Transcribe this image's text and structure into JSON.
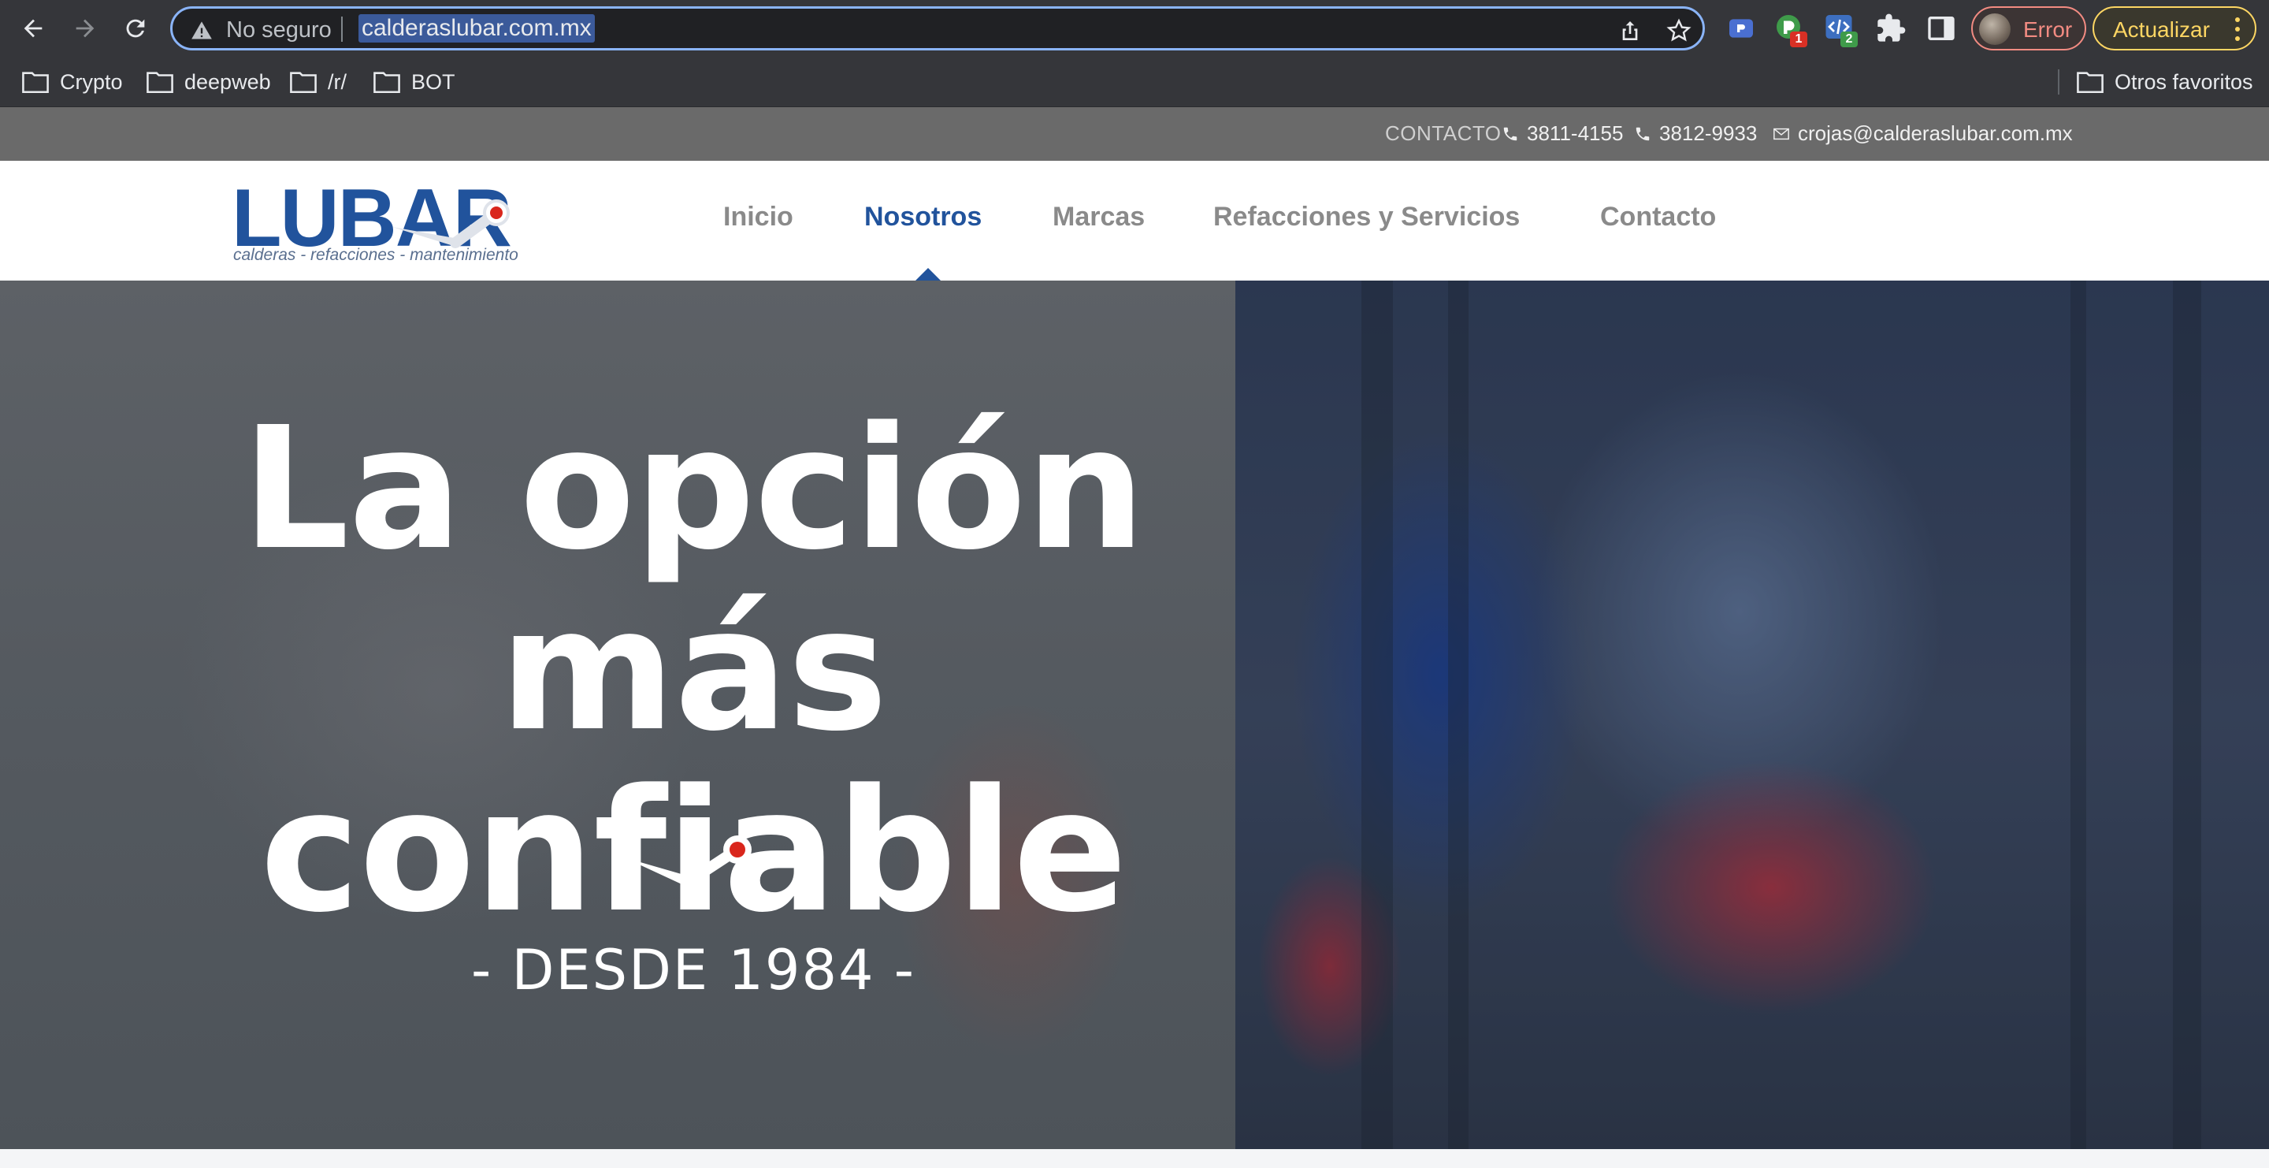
{
  "browser": {
    "security_label": "No seguro",
    "url": "calderaslubar.com.mx",
    "extension_badges": [
      "1",
      "2"
    ],
    "profile_label": "Error",
    "update_label": "Actualizar",
    "icons": [
      "back-icon",
      "forward-icon",
      "reload-icon",
      "warning-icon",
      "share-icon",
      "star-icon",
      "extension-icon",
      "puzzle-icon",
      "sidepanel-icon",
      "more-icon",
      "folder-icon"
    ],
    "accent_colors": {
      "focus": "#8ab4f8",
      "error": "#f28b82",
      "update": "#fdd663"
    }
  },
  "bookmarks": {
    "items": [
      "Crypto",
      "deepweb",
      "/r/",
      "BOT"
    ],
    "other": "Otros favoritos"
  },
  "site": {
    "topbar": {
      "contact_label": "CONTACTO",
      "phone1": "3811-4155",
      "phone2": "3812-9933",
      "email": "crojas@calderaslubar.com.mx"
    },
    "logo": {
      "word": "LUBAR",
      "tagline": "calderas - refacciones - mantenimiento"
    },
    "nav": [
      {
        "label": "Inicio",
        "active": false
      },
      {
        "label": "Nosotros",
        "active": true
      },
      {
        "label": "Marcas",
        "active": false
      },
      {
        "label": "Refacciones y Servicios",
        "active": false
      },
      {
        "label": "Contacto",
        "active": false
      }
    ],
    "hero": {
      "line1": "La opción",
      "line2": "más confiable",
      "subtitle": "- DESDE 1984 -"
    },
    "colors": {
      "brand": "#21539c",
      "gauge_red": "#d9261c"
    }
  }
}
